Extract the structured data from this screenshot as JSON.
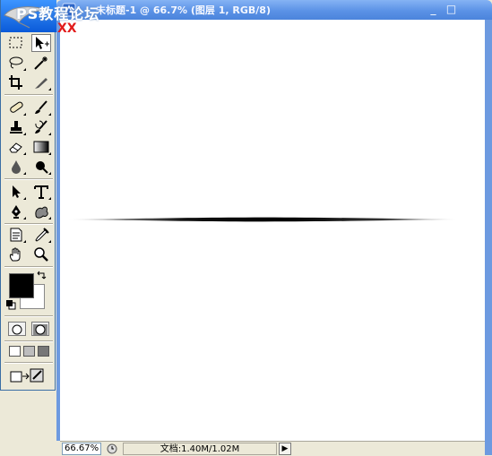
{
  "watermark": {
    "title": "PS教程论坛",
    "subtitle": "XX"
  },
  "document": {
    "title": "未标题-1 @ 66.7% (图层 1, RGB/8)",
    "minimize_glyph": "_",
    "maximize_glyph": "□"
  },
  "statusbar": {
    "zoom": "66.67%",
    "doc_info": "文档:1.40M/1.02M",
    "menu_arrow_glyph": "▶"
  },
  "colors": {
    "foreground": "#000000",
    "background": "#ffffff",
    "titlebar": "#5b92e6"
  },
  "tools": [
    [
      "marquee-tool",
      "move-tool"
    ],
    [
      "lasso-tool",
      "magic-wand-tool"
    ],
    [
      "crop-tool",
      "slice-tool"
    ],
    [
      "healing-brush-tool",
      "brush-tool"
    ],
    [
      "clone-stamp-tool",
      "history-brush-tool"
    ],
    [
      "eraser-tool",
      "gradient-tool"
    ],
    [
      "blur-tool",
      "dodge-tool"
    ],
    [
      "path-selection-tool",
      "type-tool"
    ],
    [
      "pen-tool",
      "custom-shape-tool"
    ],
    [
      "notes-tool",
      "eyedropper-tool"
    ],
    [
      "hand-tool",
      "zoom-tool"
    ]
  ]
}
